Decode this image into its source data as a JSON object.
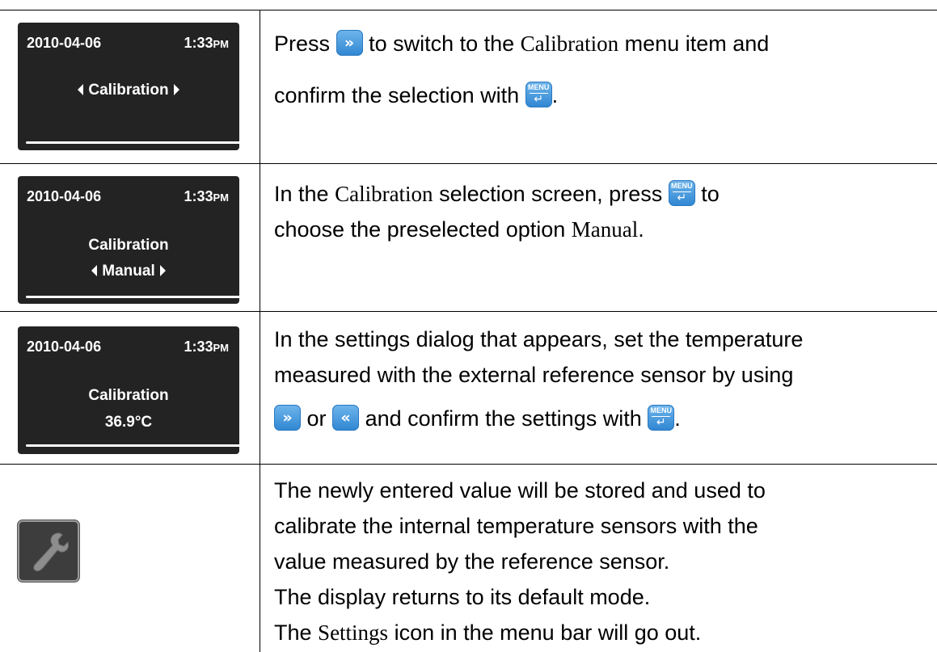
{
  "screens": [
    {
      "date": "2010-04-06",
      "time": "1:33",
      "ampm": "PM",
      "line1": "Calibration"
    },
    {
      "date": "2010-04-06",
      "time": "1:33",
      "ampm": "PM",
      "line1": "Calibration",
      "line2": "Manual"
    },
    {
      "date": "2010-04-06",
      "time": "1:33",
      "ampm": "PM",
      "line1": "Calibration",
      "line2": "36.9°C"
    }
  ],
  "keys": {
    "menu_label": "MENU",
    "enter_glyph": "↵",
    "next_glyph": "»",
    "prev_glyph": "«"
  },
  "steps": {
    "s1": {
      "a": "Press",
      "b": "to switch to the",
      "c": "Calibration",
      "d": "menu item and",
      "e": "confirm the selection with",
      "f": "."
    },
    "s2": {
      "a": "In the",
      "b": "Calibration",
      "c": "selection screen, press",
      "d": "to",
      "e": "choose the preselected option",
      "f": "Manual",
      "g": "."
    },
    "s3": {
      "a": "In the settings dialog that appears, set the temperature",
      "b": "measured with the external reference sensor by using",
      "c": "or",
      "d": "and confirm the settings with",
      "e": "."
    },
    "s4": {
      "lines": [
        "The newly entered value will be stored and used to",
        "calibrate the internal temperature sensors with the",
        "value measured by the reference sensor.",
        "The display returns to its default mode."
      ],
      "last_a": "The",
      "last_b": "Settings",
      "last_c": "icon in the menu bar will go out."
    }
  },
  "icons": [
    "chevron-left-icon",
    "chevron-right-icon",
    "next-key-icon",
    "prev-key-icon",
    "menu-enter-key-icon",
    "wrench-settings-icon"
  ]
}
